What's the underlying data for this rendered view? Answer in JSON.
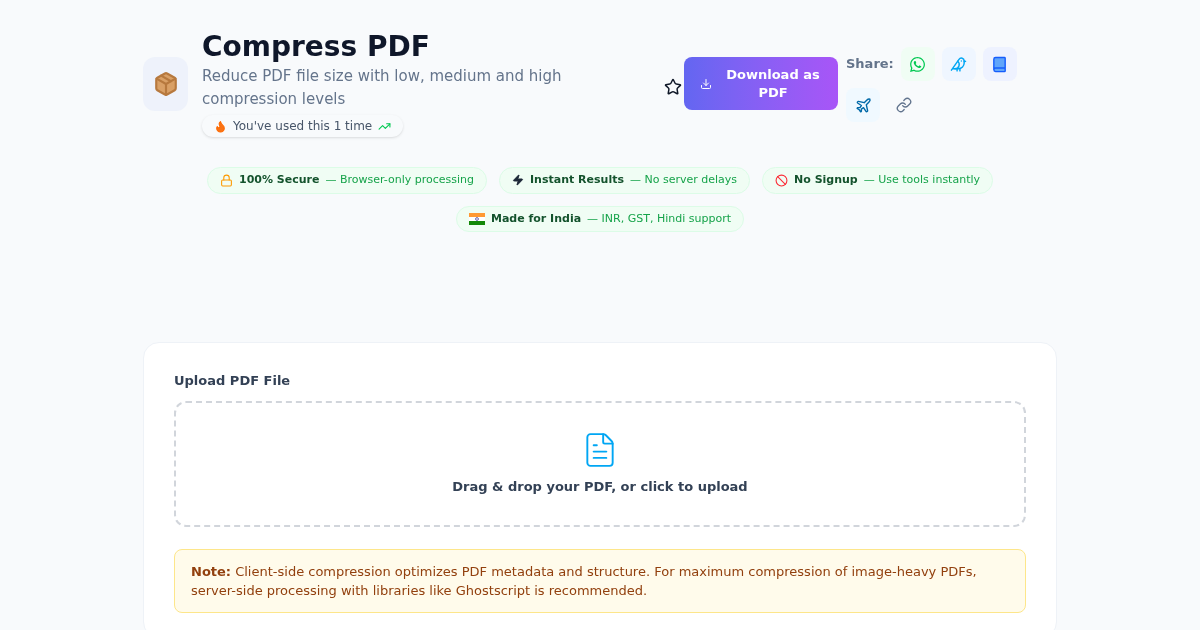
{
  "header": {
    "title": "Compress PDF",
    "subtitle": "Reduce PDF file size with low, medium and high compression levels",
    "usage": "You've used this 1 time",
    "favorite": false,
    "download_button": "Download as PDF",
    "share_label": "Share:"
  },
  "badges": [
    {
      "kind": "lock",
      "title": "100% Secure",
      "detail": "— Browser-only processing"
    },
    {
      "kind": "bolt",
      "title": "Instant Results",
      "detail": "— No server delays"
    },
    {
      "kind": "ban",
      "title": "No Signup",
      "detail": "— Use tools instantly"
    },
    {
      "kind": "flag",
      "title": "Made for India",
      "detail": "— INR, GST, Hindi support"
    }
  ],
  "upload": {
    "label": "Upload PDF File",
    "prompt": "Drag & drop your PDF, or click to upload"
  },
  "note": "**Note:** Client-side compression optimizes PDF metadata and structure. For maximum compression of image-heavy PDFs, server-side processing with libraries like Ghostscript is recommended."
}
